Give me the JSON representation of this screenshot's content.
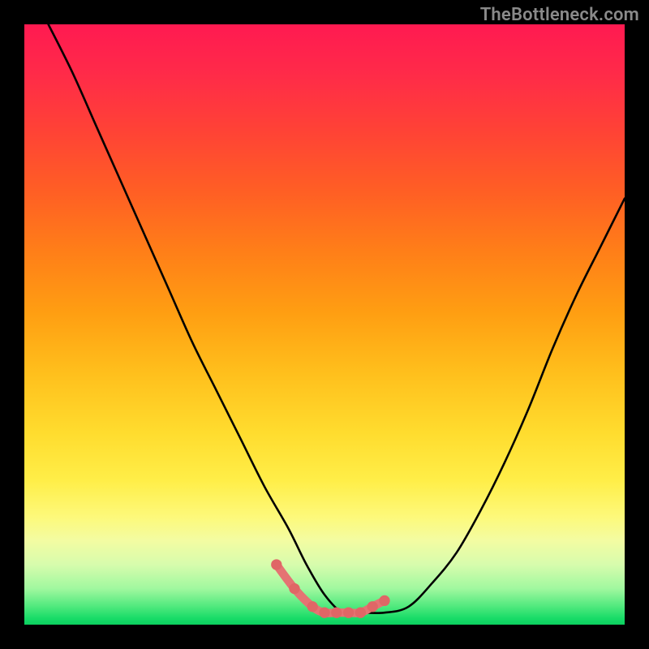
{
  "watermark": {
    "text": "TheBottleneck.com"
  },
  "chart_data": {
    "type": "line",
    "title": "",
    "xlabel": "",
    "ylabel": "",
    "xlim": [
      0,
      100
    ],
    "ylim": [
      0,
      100
    ],
    "grid": false,
    "legend": false,
    "series": [
      {
        "name": "curve",
        "x": [
          4,
          8,
          12,
          16,
          20,
          24,
          28,
          32,
          36,
          40,
          44,
          47,
          50,
          53,
          56,
          60,
          64,
          68,
          72,
          76,
          80,
          84,
          88,
          92,
          96,
          100
        ],
        "values": [
          100,
          92,
          83,
          74,
          65,
          56,
          47,
          39,
          31,
          23,
          16,
          10,
          5,
          2,
          2,
          2,
          3,
          7,
          12,
          19,
          27,
          36,
          46,
          55,
          63,
          71
        ]
      }
    ],
    "highlight": {
      "note": "pink/red accent segment near the minimum",
      "x": [
        42,
        45,
        48,
        50,
        52,
        54,
        56,
        58,
        60
      ],
      "values": [
        10,
        6,
        3,
        2,
        2,
        2,
        2,
        3,
        4
      ]
    },
    "background_gradient": {
      "orientation": "vertical",
      "stops": [
        {
          "pos": 0.0,
          "color": "#ff1a51"
        },
        {
          "pos": 0.18,
          "color": "#ff4335"
        },
        {
          "pos": 0.38,
          "color": "#ff7f18"
        },
        {
          "pos": 0.58,
          "color": "#ffbf1c"
        },
        {
          "pos": 0.76,
          "color": "#ffee48"
        },
        {
          "pos": 0.9,
          "color": "#d7fcad"
        },
        {
          "pos": 1.0,
          "color": "#0ccf5f"
        }
      ]
    }
  }
}
